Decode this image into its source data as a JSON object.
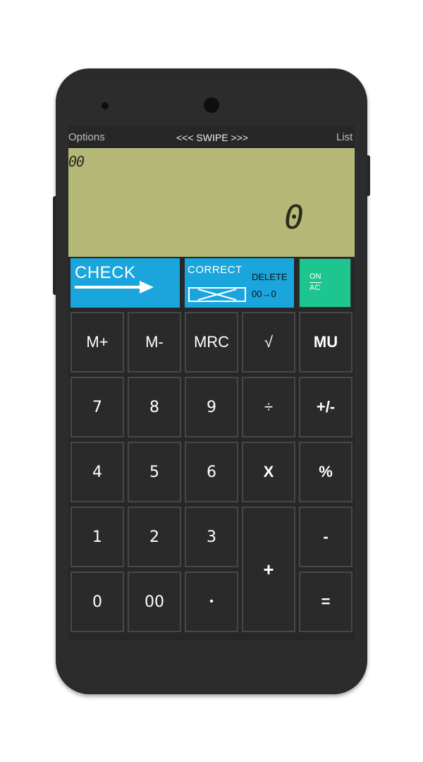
{
  "status_bar": {
    "left": "Options",
    "center": "<<< SWIPE >>>",
    "right": "List"
  },
  "display": {
    "memory": "00",
    "value": "0"
  },
  "function_keys": {
    "check": "CHECK",
    "correct": "CORRECT",
    "delete": "DELETE",
    "zero_conv": "00→0",
    "on": "ON",
    "ac": "AC"
  },
  "keys": {
    "m_plus": "M+",
    "m_minus": "M-",
    "mrc": "MRC",
    "sqrt": "√",
    "mu": "MU",
    "k7": "7",
    "k8": "8",
    "k9": "9",
    "divide": "÷",
    "plus_minus": "+/-",
    "k4": "4",
    "k5": "5",
    "k6": "6",
    "multiply": "X",
    "percent": "%",
    "k1": "1",
    "k2": "2",
    "k3": "3",
    "plus": "+",
    "minus": "-",
    "k0": "0",
    "k00": "00",
    "dot": "•",
    "equals": "="
  },
  "colors": {
    "lcd": "#b5b877",
    "blue_key": "#1aa6dd",
    "green_key": "#1cc68e",
    "key_bg": "#2a2a2a"
  }
}
